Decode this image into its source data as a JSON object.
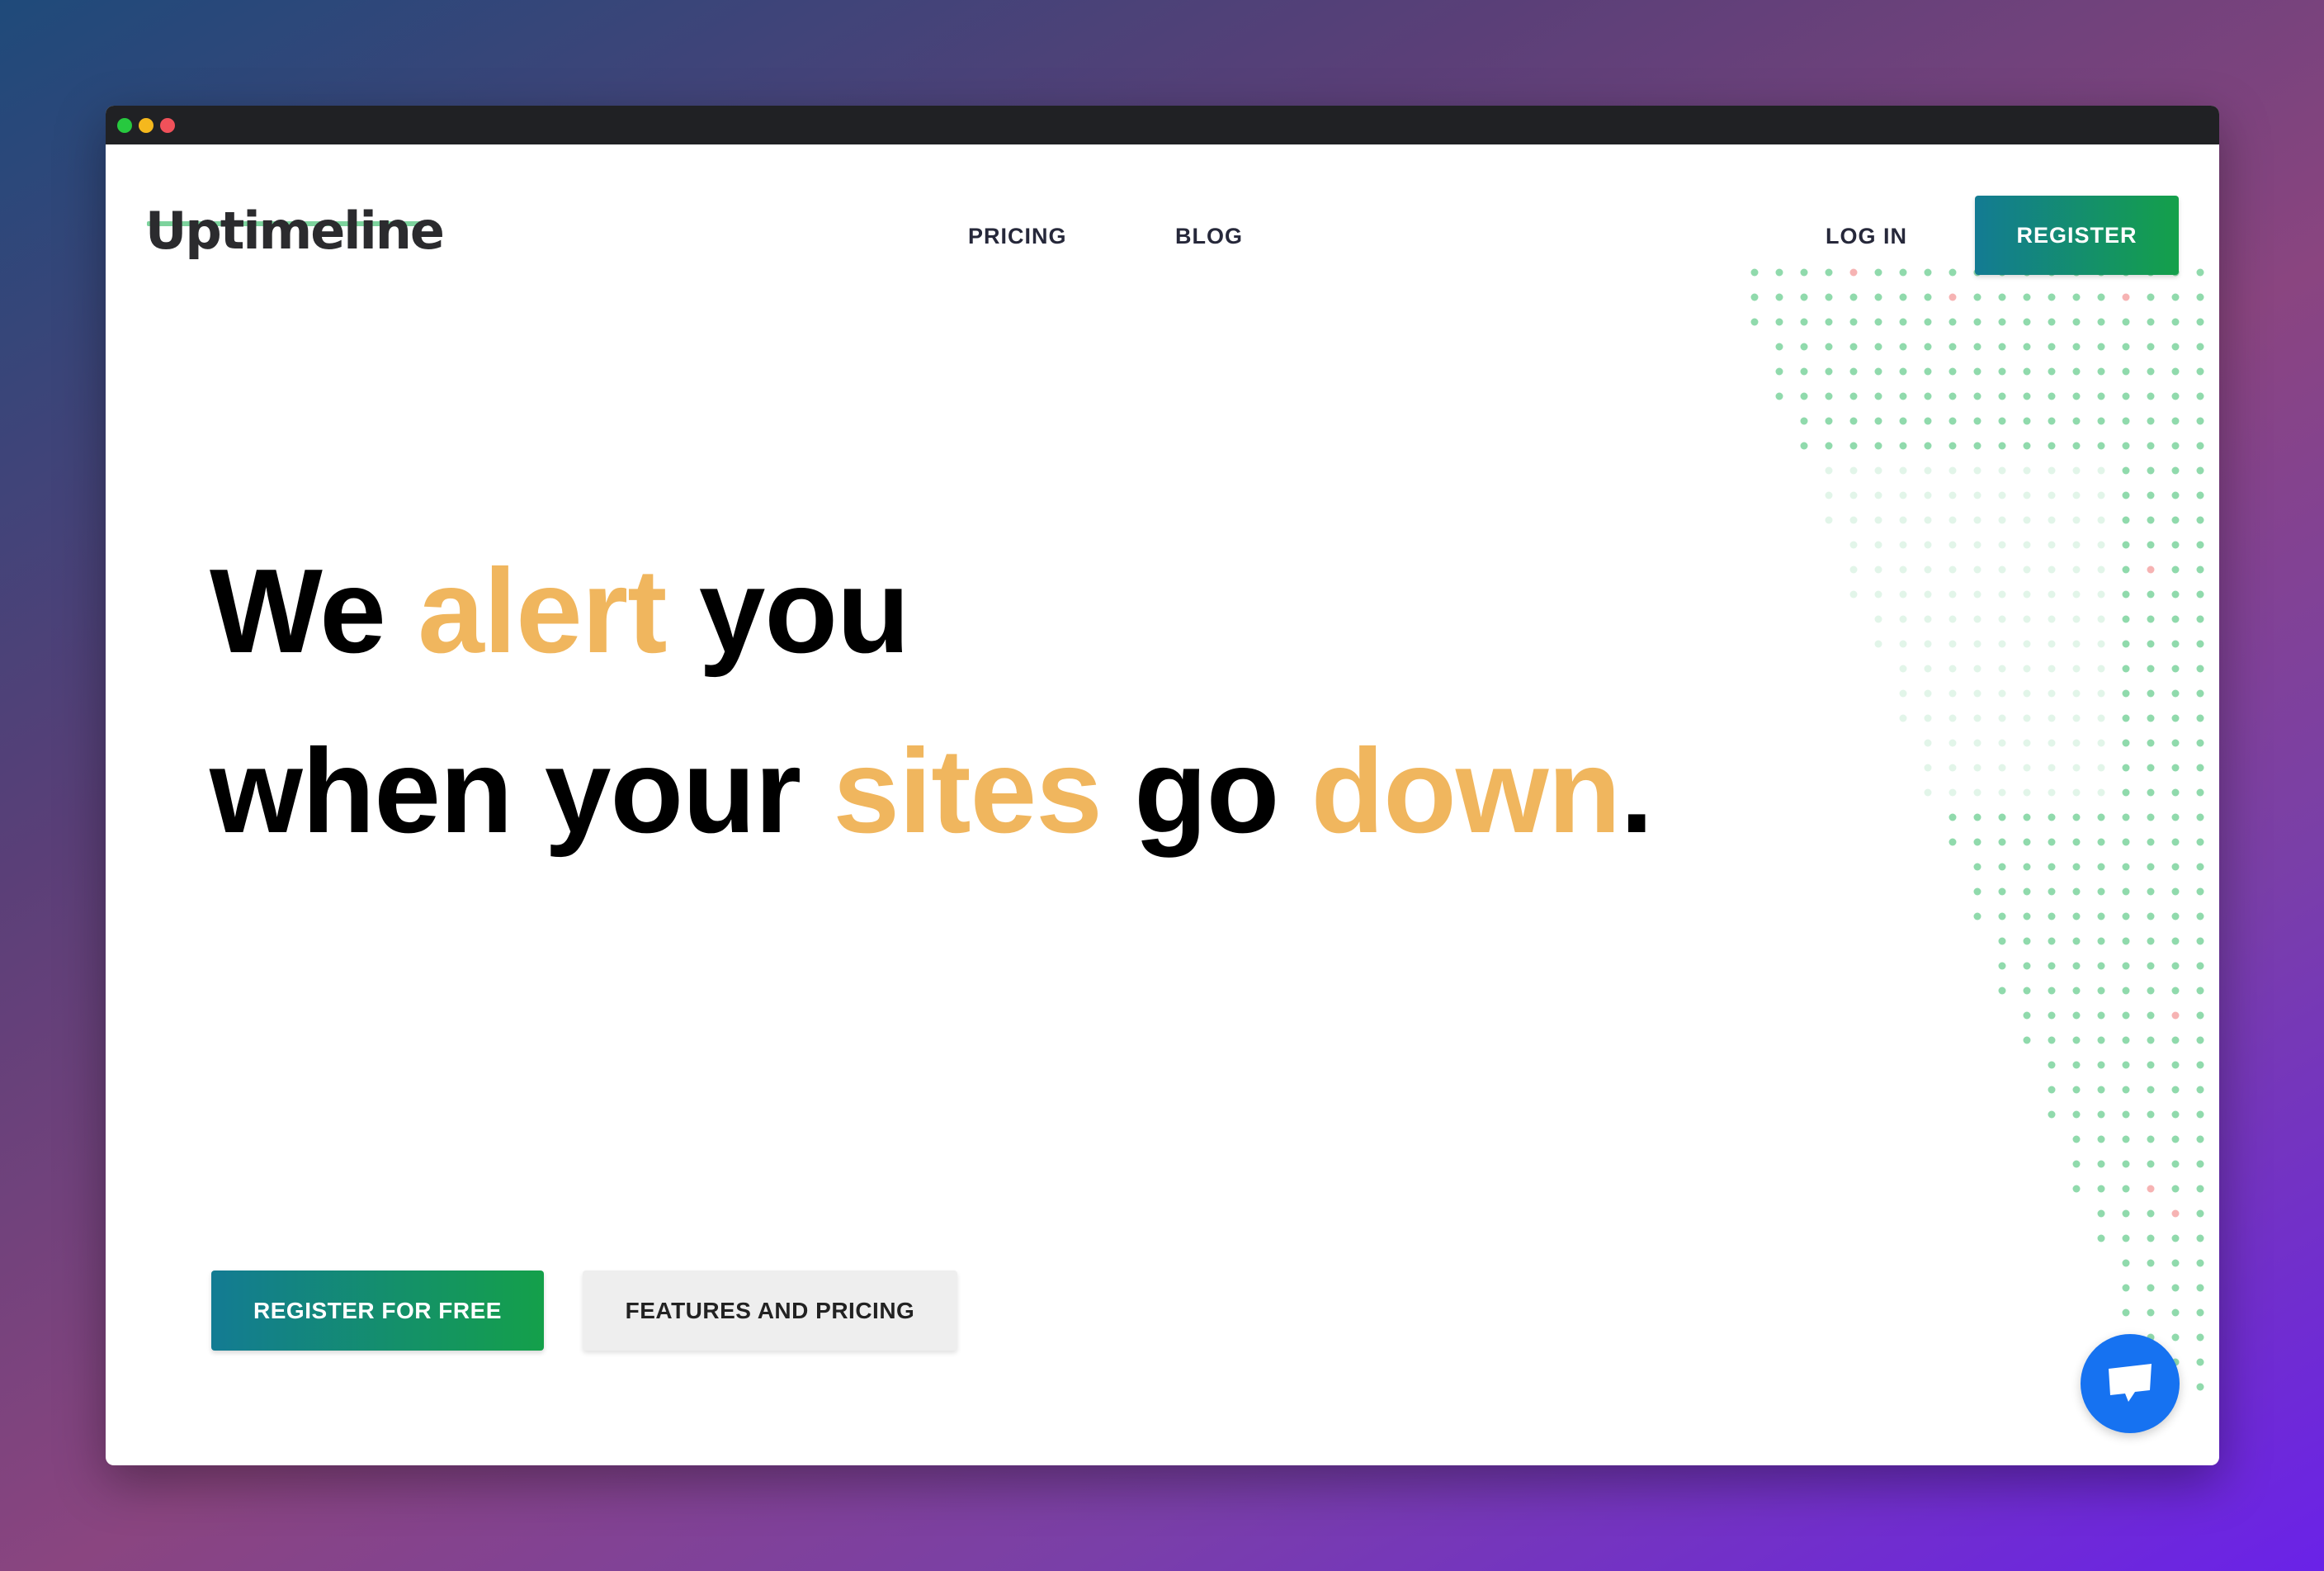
{
  "window": {
    "controls": [
      "green",
      "yellow",
      "red"
    ]
  },
  "header": {
    "logo": "Uptimeline",
    "nav": {
      "pricing": "PRICING",
      "blog": "BLOG"
    },
    "login": "LOG IN",
    "register": "REGISTER"
  },
  "hero": {
    "line1": {
      "w1": "We",
      "w2": "alert",
      "w3": "you"
    },
    "line2": {
      "w1": "when your",
      "w2": "sites",
      "w3": "go",
      "w4": "down",
      "w5": "."
    }
  },
  "cta": {
    "primary": "REGISTER FOR FREE",
    "secondary": "FEATURES AND PRICING"
  },
  "chat": {
    "icon": "chat-bubble-icon"
  },
  "colors": {
    "accent": "#f0b65e",
    "brand_gradient_start": "#137b93",
    "brand_gradient_end": "#14a04a",
    "dot_green": "#7dd39d",
    "dot_red": "#f4a6a6",
    "chat": "#1672f1"
  }
}
